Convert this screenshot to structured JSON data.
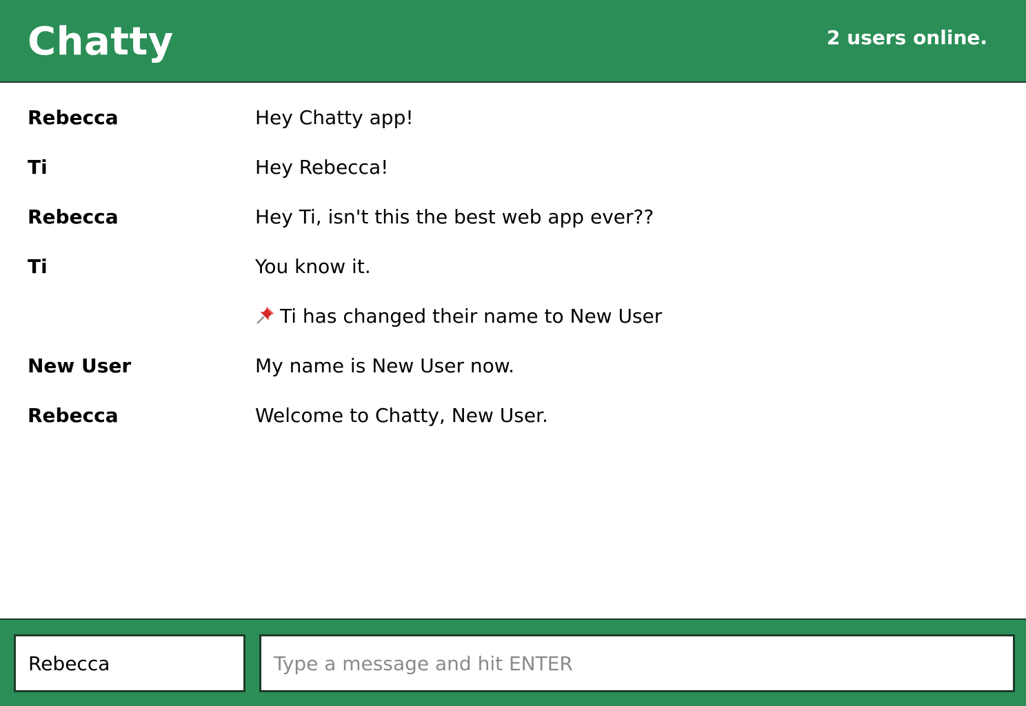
{
  "navbar": {
    "brand": "Chatty",
    "online_count": "2 users online."
  },
  "messages": [
    {
      "username": "Rebecca",
      "content": "Hey Chatty app!"
    },
    {
      "username": "Ti",
      "content": "Hey Rebecca!"
    },
    {
      "username": "Rebecca",
      "content": "Hey Ti, isn't this the best web app ever??"
    },
    {
      "username": "Ti",
      "content": "You know it."
    },
    {
      "username": "",
      "content": "Ti has changed their name to New User",
      "icon": "pushpin-icon"
    },
    {
      "username": "New User",
      "content": "My name is New User now."
    },
    {
      "username": "Rebecca",
      "content": "Welcome to Chatty, New User."
    }
  ],
  "composer": {
    "name_value": "Rebecca",
    "message_value": "",
    "message_placeholder": "Type a message and hit ENTER"
  },
  "colors": {
    "brand_green": "#2b8e57",
    "border_dark": "#1d3a28",
    "pin_red": "#d62b2b"
  }
}
